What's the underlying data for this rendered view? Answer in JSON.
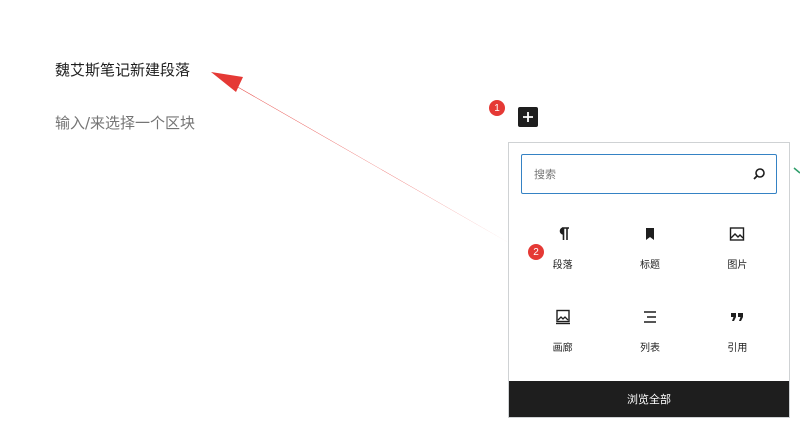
{
  "editor": {
    "paragraph_text": "魏艾斯笔记新建段落",
    "placeholder_text": "输入/来选择一个区块"
  },
  "inserter": {
    "toggle_icon": "plus-icon",
    "search_placeholder": "搜索",
    "search_icon": "search-icon",
    "blocks": [
      {
        "label": "段落",
        "icon": "paragraph-icon"
      },
      {
        "label": "标题",
        "icon": "bookmark-heading-icon"
      },
      {
        "label": "图片",
        "icon": "image-icon"
      },
      {
        "label": "画廊",
        "icon": "gallery-icon"
      },
      {
        "label": "列表",
        "icon": "list-icon"
      },
      {
        "label": "引用",
        "icon": "quote-icon"
      }
    ],
    "browse_all_label": "浏览全部"
  },
  "annotations": {
    "callout_1": "1",
    "callout_2": "2"
  },
  "colors": {
    "annotation_red": "#e53935",
    "accent_blue": "#3582c4",
    "dark": "#1e1e1e"
  }
}
